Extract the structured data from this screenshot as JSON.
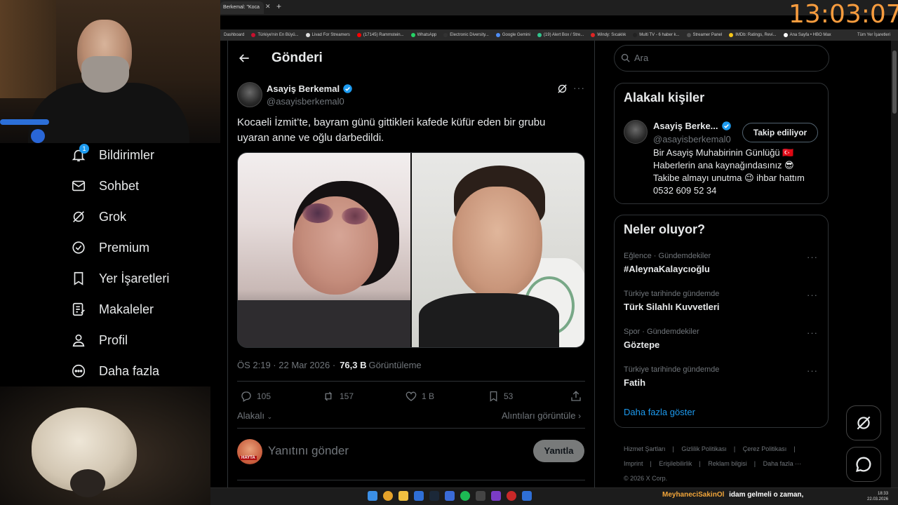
{
  "browser": {
    "tab_title": "Berkemal: \"Koca",
    "bookmarks": [
      "Dashboard",
      "Türkiye'nin En Büyü...",
      "Livad For Streamers",
      "(17145) Rammstein...",
      "WhatsApp",
      "Electronic Diversity...",
      "Google Gemini",
      "(19) Alert Box / Stre...",
      "Windy: Sıcaklık",
      "Multi TV - 6 haber k...",
      "Streamer Panel",
      "IMDb: Ratings, Revi...",
      "Ana Sayfa • HBO Max"
    ],
    "bookmarks_other": "Tüm Yer İşaretleri"
  },
  "overlay": {
    "clock": "13:03:07",
    "colors": {
      "clock": "#f79c3e"
    }
  },
  "nav": {
    "items": [
      {
        "label": "Bildirimler",
        "icon": "bell-icon",
        "badge": "1"
      },
      {
        "label": "Sohbet",
        "icon": "mail-icon"
      },
      {
        "label": "Grok",
        "icon": "grok-icon"
      },
      {
        "label": "Premium",
        "icon": "verified-badge-icon"
      },
      {
        "label": "Yer İşaretleri",
        "icon": "bookmark-icon"
      },
      {
        "label": "Makaleler",
        "icon": "article-icon"
      },
      {
        "label": "Profil",
        "icon": "person-icon"
      },
      {
        "label": "Daha fazla",
        "icon": "more-circle-icon"
      }
    ]
  },
  "header": {
    "title": "Gönderi"
  },
  "post": {
    "author_name": "Asayiş Berkemal",
    "author_handle": "@asayisberkemal0",
    "text": "Kocaeli İzmit’te, bayram günü gittikleri kafede küfür eden bir grubu uyaran anne ve oğlu darbedildi.",
    "time": "ÖS 2:19 · 22 Mar 2026 · ",
    "views_count": "76,3 B",
    "views_label": "Görüntüleme",
    "replies": "105",
    "reposts": "157",
    "likes": "1 B",
    "bookmarks": "53",
    "relevant_label": "Alakalı",
    "quotes_label": "Alıntıları görüntüle",
    "reply_placeholder": "Yanıtını gönder",
    "reply_button": "Yanıtla",
    "reply_avatar_text": "HAYTA"
  },
  "right": {
    "search_placeholder": "Ara",
    "related_title": "Alakalı kişiler",
    "person": {
      "name": "Asayiş Berke...",
      "handle": "@asayisberkemal0",
      "follow_label": "Takip ediliyor",
      "bio_1": "Bir Asayiş Muhabirinin Günlüğü 🇹🇷",
      "bio_2": "Haberlerin ana kaynağındasınız 😎",
      "bio_3": "Takibe almayı unutma 😉 ihbar hattım",
      "bio_4": "0532 609 52 34"
    },
    "trends_title": "Neler oluyor?",
    "trends": [
      {
        "category": "Eğlence · Gündemdekiler",
        "name": "#AleynaKalaycıoğlu"
      },
      {
        "category": "Türkiye tarihinde gündemde",
        "name": "Türk Silahlı Kuvvetleri"
      },
      {
        "category": "Spor · Gündemdekiler",
        "name": "Göztepe"
      },
      {
        "category": "Türkiye tarihinde gündemde",
        "name": "Fatih"
      }
    ],
    "show_more": "Daha fazla göster",
    "footer": [
      "Hizmet Şartları",
      "Gizlilik Politikası",
      "Çerez Politikası",
      "Imprint",
      "Erişilebilirlik",
      "Reklam bilgisi",
      "Daha fazla ···",
      "© 2026 X Corp."
    ]
  },
  "taskbar": {
    "ticker_user": "MeyhaneciSakinOl",
    "ticker_msg": "idam gelmeli o zaman,",
    "tray_time": "18:33",
    "tray_date": "22.03.2026"
  }
}
